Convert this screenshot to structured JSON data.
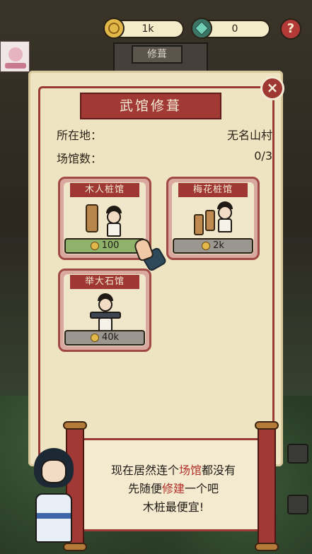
{
  "background": {
    "sign_text": "修葺"
  },
  "currency": {
    "coins": {
      "icon": "coin-icon",
      "value": "1k"
    },
    "jade": {
      "icon": "jade-icon",
      "value": "0"
    },
    "help_label": "?"
  },
  "panel": {
    "title": "武馆修葺",
    "close_label": "×",
    "location_label": "所在地：",
    "location_value": "无名山村",
    "count_label": "场馆数：",
    "count_value": "0/3"
  },
  "buildings": [
    {
      "name": "木人桩馆",
      "price": "100",
      "state": "affordable",
      "color": "#8fb26a"
    },
    {
      "name": "梅花桩馆",
      "price": "2k",
      "state": "locked",
      "color": "#9b9790"
    },
    {
      "name": "举大石馆",
      "price": "40k",
      "state": "locked",
      "color": "#9b9790"
    }
  ],
  "dialog": {
    "line1_pre": "现在居然连个",
    "line1_hl": "场馆",
    "line1_post": "都没有",
    "line2_pre": "先随便",
    "line2_hl": "修建",
    "line2_post": "一个吧",
    "line3": "木桩最便宜!"
  },
  "colors": {
    "accent_red": "#a13a35",
    "parchment": "#efe4c2"
  }
}
